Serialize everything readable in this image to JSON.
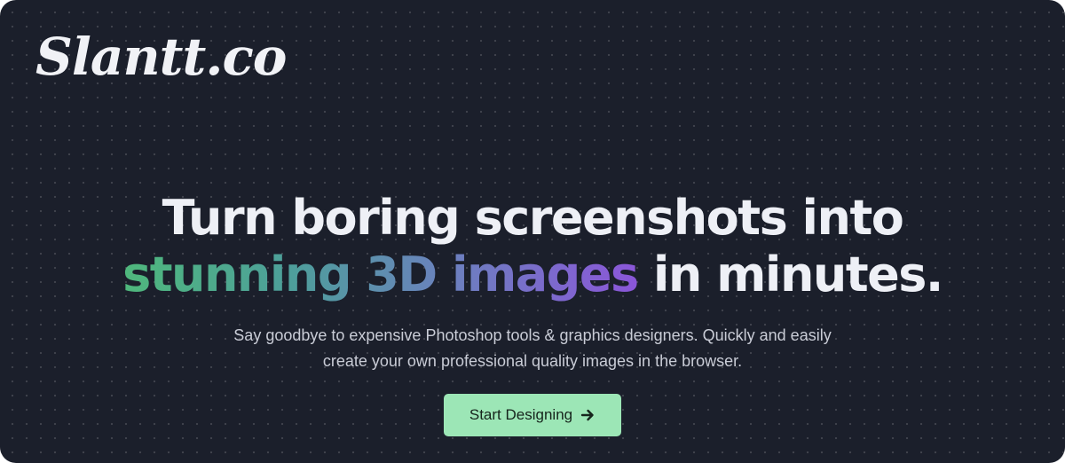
{
  "brand": {
    "logo_text": "Slantt.co"
  },
  "hero": {
    "headline_line1": "Turn boring screenshots into",
    "headline_highlight": "stunning 3D images",
    "headline_rest": " in minutes.",
    "subtitle": "Say goodbye to expensive Photoshop tools & graphics designers. Quickly and easily create your own professional quality images in the browser."
  },
  "cta": {
    "label": "Start Designing",
    "icon": "arrow-right-icon"
  },
  "colors": {
    "background": "#1b1f2b",
    "text": "#eef0f6",
    "gradient_start": "#4fb87c",
    "gradient_end": "#8b56d9",
    "button": "#9ce6b6"
  }
}
